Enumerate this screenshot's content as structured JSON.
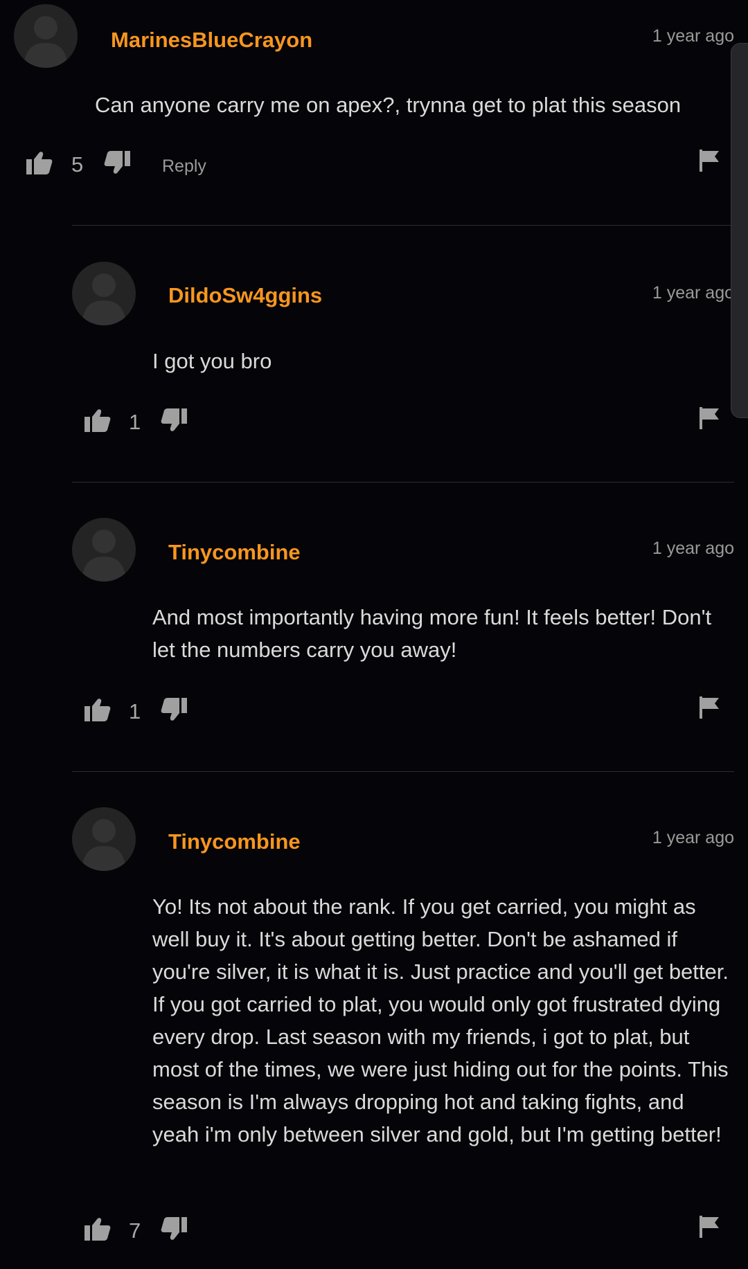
{
  "comments": [
    {
      "username": "MarinesBlueCrayon",
      "time": "1 year ago",
      "text": "Can anyone carry me on apex?, trynna get to plat this season",
      "likes": "5",
      "reply_label": "Reply"
    },
    {
      "username": "DildoSw4ggins",
      "time": "1 year ago",
      "text": "I got you bro",
      "likes": "1"
    },
    {
      "username": "Tinycombine",
      "time": "1 year ago",
      "text": "And most importantly having more fun! It feels better! Don't let the numbers carry you away!",
      "likes": "1"
    },
    {
      "username": "Tinycombine",
      "time": "1 year ago",
      "text": "Yo! Its not about the rank. If you get carried, you might as well buy it. It's about getting better. Don't be ashamed if you're silver, it is what it is. Just practice and you'll get better. If you got carried to plat, you would only got frustrated dying every drop. Last season with my friends, i got to plat, but most of the times, we were just hiding out for the points. This season is I'm always dropping hot and taking fights, and yeah i'm only between silver and gold, but I'm getting better!",
      "likes": "7"
    }
  ],
  "icons": {
    "like": "thumbs-up-icon",
    "dislike": "thumbs-down-icon",
    "flag": "flag-icon",
    "avatar": "default-user-avatar"
  },
  "colors": {
    "username": "#f7961f",
    "background": "#050408"
  }
}
